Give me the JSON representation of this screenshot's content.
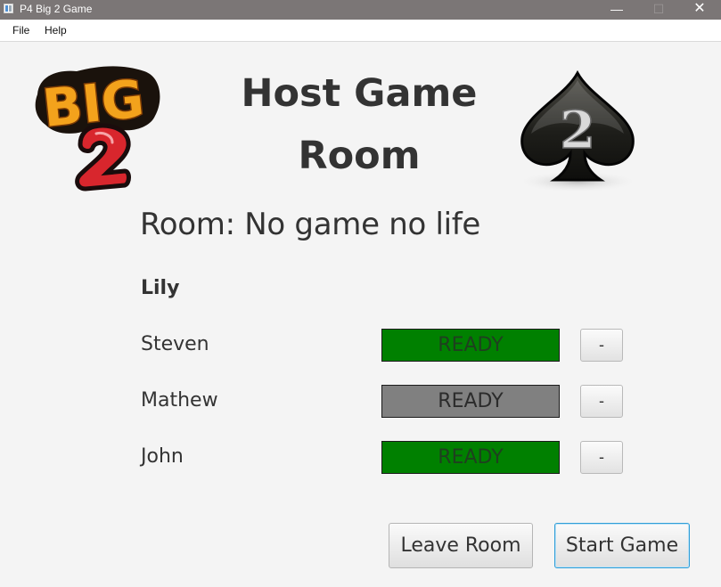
{
  "window": {
    "title": "P4 Big 2 Game",
    "minimize_glyph": "—",
    "maximize_glyph": "☐",
    "close_glyph": "✕"
  },
  "menu": {
    "items": [
      {
        "label": "File"
      },
      {
        "label": "Help"
      }
    ]
  },
  "logos": {
    "left_text": "BIG",
    "left_number": "2",
    "right_number": "2"
  },
  "header": {
    "title_line1": "Host Game",
    "title_line2": "Room"
  },
  "room": {
    "label": "Room: No game no life"
  },
  "host": {
    "name": "Lily"
  },
  "players": [
    {
      "name": "Steven",
      "status": "READY",
      "status_color": "#008000",
      "text_color": "#1f3f1f",
      "kick_label": "-"
    },
    {
      "name": "Mathew",
      "status": "READY",
      "status_color": "#808080",
      "text_color": "#2b2b2b",
      "kick_label": "-"
    },
    {
      "name": "John",
      "status": "READY",
      "status_color": "#008000",
      "text_color": "#1f3f1f",
      "kick_label": "-"
    }
  ],
  "actions": {
    "leave_label": "Leave Room",
    "start_label": "Start Game"
  }
}
